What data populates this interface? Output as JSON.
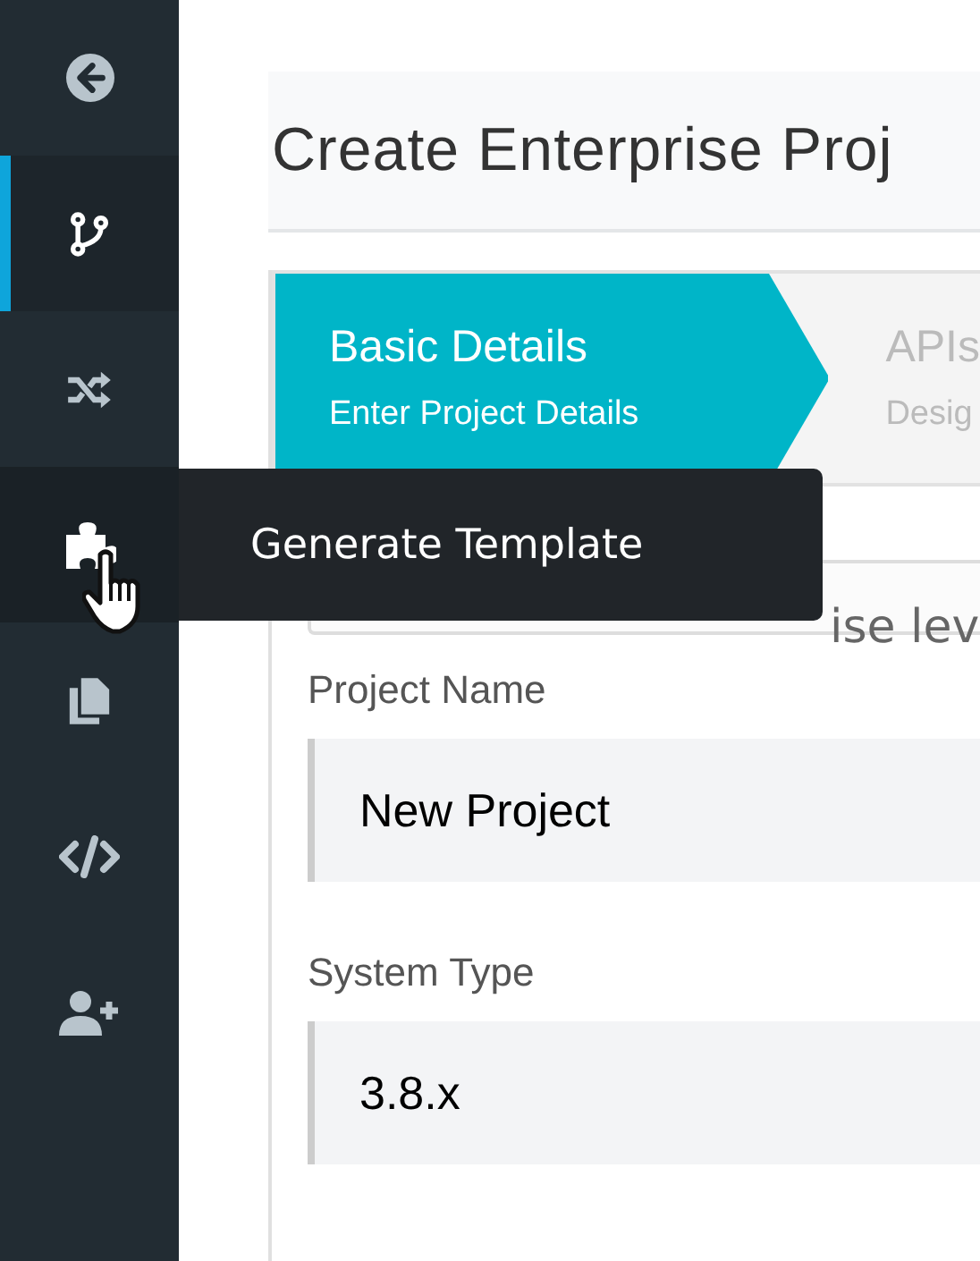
{
  "sidebar": {
    "items": [
      {
        "selected": false,
        "hovered": false
      },
      {
        "selected": true,
        "hovered": false
      },
      {
        "selected": false,
        "hovered": false
      },
      {
        "selected": false,
        "hovered": true
      },
      {
        "selected": false,
        "hovered": false
      },
      {
        "selected": false,
        "hovered": false
      },
      {
        "selected": false,
        "hovered": false
      }
    ]
  },
  "tooltip": {
    "text": "Generate Template"
  },
  "header": {
    "title": "Create Enterprise Proj"
  },
  "steps": [
    {
      "title": "Basic Details",
      "subtitle": "Enter Project Details",
      "selected": true
    },
    {
      "title": "APIs",
      "subtitle": "Desig",
      "selected": false
    }
  ],
  "description": {
    "value": "ise lev"
  },
  "fields": [
    {
      "label": "Project Name",
      "value": "New Project"
    },
    {
      "label": "System Type",
      "value": "3.8.x"
    }
  ]
}
